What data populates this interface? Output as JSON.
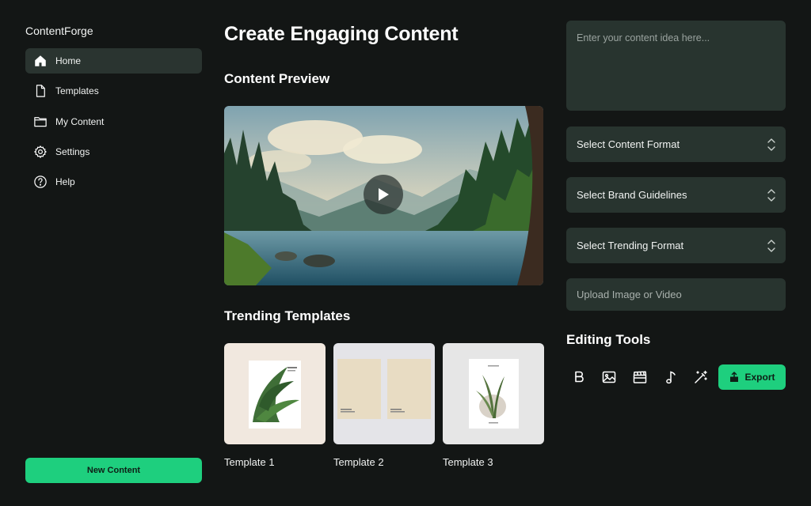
{
  "brand": "ContentForge",
  "sidebar": {
    "items": [
      {
        "label": "Home",
        "icon": "home-icon",
        "active": true
      },
      {
        "label": "Templates",
        "icon": "file-icon"
      },
      {
        "label": "My Content",
        "icon": "folder-icon"
      },
      {
        "label": "Settings",
        "icon": "gear-icon"
      },
      {
        "label": "Help",
        "icon": "help-circle-icon"
      }
    ],
    "new_content_label": "New Content"
  },
  "main": {
    "title": "Create Engaging Content",
    "preview_title": "Content Preview",
    "trending_title": "Trending Templates",
    "templates": [
      {
        "label": "Template 1"
      },
      {
        "label": "Template 2"
      },
      {
        "label": "Template 3"
      }
    ]
  },
  "panel": {
    "idea_placeholder": "Enter your content idea here...",
    "selects": [
      {
        "label": "Select Content Format"
      },
      {
        "label": "Select Brand Guidelines"
      },
      {
        "label": "Select Trending Format"
      }
    ],
    "upload_label": "Upload Image or Video",
    "tools_title": "Editing Tools",
    "tools": [
      "bold-icon",
      "image-icon",
      "clapperboard-icon",
      "music-note-icon",
      "magic-wand-icon"
    ],
    "export_label": "Export"
  },
  "colors": {
    "background": "#131615",
    "panel": "#28342f",
    "accent": "#1ecf7e",
    "active_nav": "#2a3430"
  }
}
